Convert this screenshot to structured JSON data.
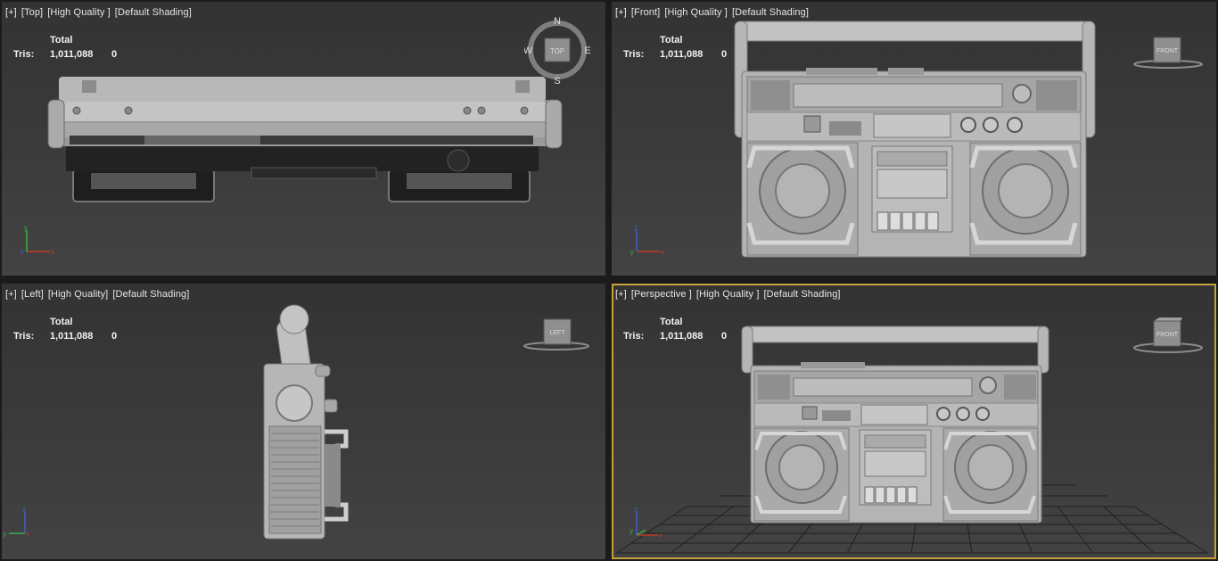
{
  "viewports": {
    "top": {
      "plus": "[+]",
      "view": "[Top]",
      "quality": "[High Quality ]",
      "shading": "[Default Shading]",
      "cube": "TOP",
      "compass": {
        "n": "N",
        "s": "S",
        "e": "E",
        "w": "W"
      }
    },
    "front": {
      "plus": "[+]",
      "view": "[Front]",
      "quality": "[High Quality ]",
      "shading": "[Default Shading]",
      "cube": "FRONT"
    },
    "left": {
      "plus": "[+]",
      "view": "[Left]",
      "quality": "[High Quality]",
      "shading": "[Default Shading]",
      "cube": "LEFT"
    },
    "perspective": {
      "plus": "[+]",
      "view": "[Perspective ]",
      "quality": "[High Quality ]",
      "shading": "[Default Shading]",
      "cube": "FRONT"
    }
  },
  "stats": {
    "total_label": "Total",
    "tris_label": "Tris:",
    "tris_total": "1,011,088",
    "tris_selected": "0"
  },
  "axis_labels": {
    "x": "x",
    "y": "y",
    "z": "z"
  },
  "colors": {
    "active_border": "#c7a23a",
    "x_axis": "#c0392b",
    "y_axis": "#3fae49",
    "z_axis": "#3a62c9",
    "model": "#b4b4b4"
  }
}
